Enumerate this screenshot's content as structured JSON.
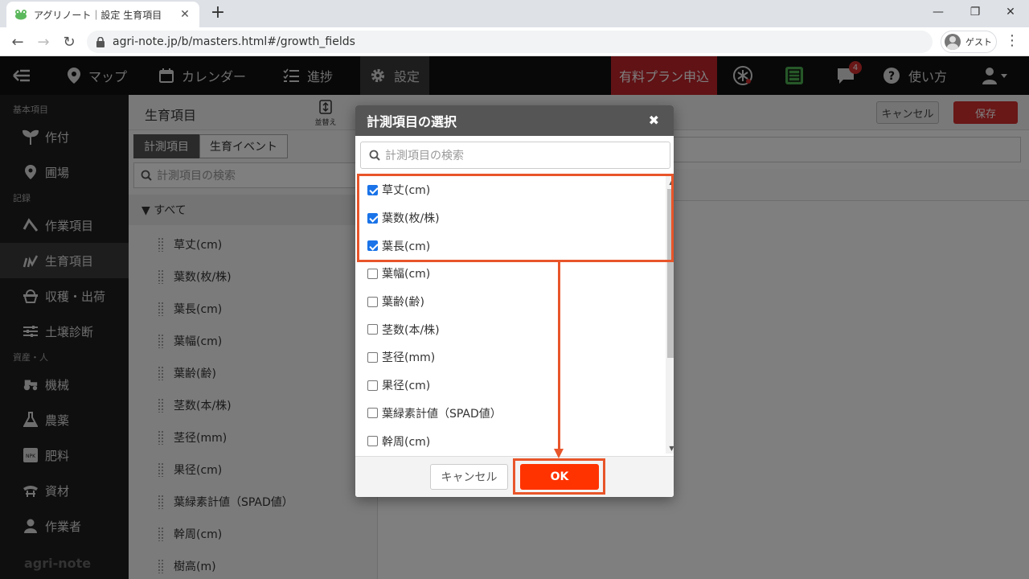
{
  "browser": {
    "tab_title": "アグリノート｜設定 生育項目",
    "tab_close": "✕",
    "new_tab": "+",
    "url": "agri-note.jp/b/masters.html#/growth_fields",
    "profile_label": "ゲスト",
    "win_min": "—",
    "win_restore": "❐",
    "win_close": "✕",
    "back": "←",
    "forward": "→",
    "reload": "↻",
    "menu": "⋮"
  },
  "header": {
    "nav": [
      {
        "label": "マップ",
        "icon": "map-pin-icon"
      },
      {
        "label": "カレンダー",
        "icon": "calendar-icon"
      },
      {
        "label": "進捗",
        "icon": "checklist-icon"
      },
      {
        "label": "設定",
        "icon": "gear-icon"
      }
    ],
    "plan_button": "有料プラン申込",
    "notification_count": "4",
    "help_label": "使い方"
  },
  "sidebar": {
    "sections": [
      {
        "title": "基本項目",
        "items": [
          {
            "label": "作付",
            "icon": "sprout-icon"
          },
          {
            "label": "圃場",
            "icon": "location-pin-icon"
          }
        ]
      },
      {
        "title": "記録",
        "items": [
          {
            "label": "作業項目",
            "icon": "task-icon"
          },
          {
            "label": "生育項目",
            "icon": "growth-icon",
            "active": true
          },
          {
            "label": "収穫・出荷",
            "icon": "basket-icon"
          },
          {
            "label": "土壌診断",
            "icon": "sliders-icon"
          }
        ]
      },
      {
        "title": "資産・人",
        "items": [
          {
            "label": "機械",
            "icon": "tractor-icon"
          },
          {
            "label": "農薬",
            "icon": "flask-icon"
          },
          {
            "label": "肥料",
            "icon": "npk-icon"
          },
          {
            "label": "資材",
            "icon": "material-icon"
          },
          {
            "label": "作業者",
            "icon": "person-icon"
          }
        ]
      }
    ],
    "logo": "agri-note"
  },
  "main": {
    "title": "生育項目",
    "sort_label": "並替え",
    "cancel_label": "キャンセル",
    "save_label": "保存",
    "subtabs": [
      "計測項目",
      "生育イベント"
    ],
    "search_placeholder": "計測項目の検索",
    "tree_root": "▼ すべて",
    "items": [
      "草丈(cm)",
      "葉数(枚/株)",
      "葉長(cm)",
      "葉幅(cm)",
      "葉齢(齢)",
      "茎数(本/株)",
      "茎径(mm)",
      "果径(cm)",
      "葉緑素計値（SPAD値）",
      "幹周(cm)",
      "樹高(m)"
    ]
  },
  "modal": {
    "title": "計測項目の選択",
    "close": "✖",
    "search_placeholder": "計測項目の検索",
    "options": [
      {
        "label": "草丈(cm)",
        "checked": true
      },
      {
        "label": "葉数(枚/株)",
        "checked": true
      },
      {
        "label": "葉長(cm)",
        "checked": true
      },
      {
        "label": "葉幅(cm)",
        "checked": false
      },
      {
        "label": "葉齢(齢)",
        "checked": false
      },
      {
        "label": "茎数(本/株)",
        "checked": false
      },
      {
        "label": "茎径(mm)",
        "checked": false
      },
      {
        "label": "果径(cm)",
        "checked": false
      },
      {
        "label": "葉緑素計値（SPAD値）",
        "checked": false
      },
      {
        "label": "幹周(cm)",
        "checked": false
      }
    ],
    "cancel_label": "キャンセル",
    "ok_label": "OK",
    "scroll_up": "▲",
    "scroll_down": "▼"
  },
  "colors": {
    "accent_red": "#c0252b",
    "ok_button": "#ff3300",
    "highlight": "#e8552a",
    "checkbox": "#1a73e8"
  }
}
